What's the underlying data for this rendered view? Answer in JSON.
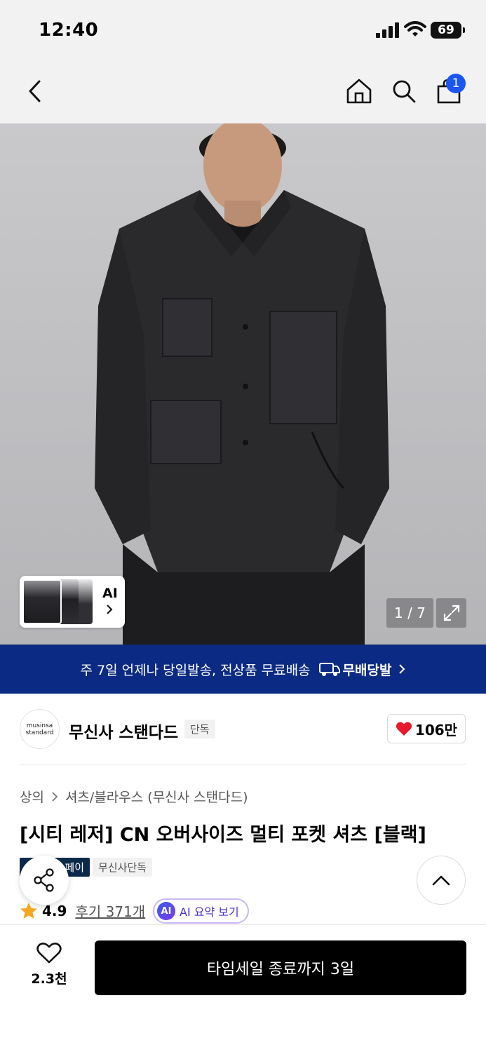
{
  "status_bar": {
    "time": "12:40",
    "battery": "69"
  },
  "nav": {
    "cart_count": "1"
  },
  "hero": {
    "ai_label": "AI",
    "counter": "1 / 7"
  },
  "banner": {
    "text": "주 7일 언제나 당일발송, 전상품 무료배송",
    "logo_text": "무배당발"
  },
  "brand": {
    "logo_text": "musinsa standard",
    "name": "무신사 스탠다드",
    "tag": "단독",
    "likes": "106만"
  },
  "product": {
    "breadcrumb": [
      "상의",
      "셔츠/블라우스 (무신사 스탠다드)"
    ],
    "title": "[시티 레저] CN 오버사이즈 멀티 포켓 셔츠 [블랙]",
    "tags": [
      "페이",
      "무신사단독"
    ],
    "rating": "4.9",
    "reviews": "후기 371개",
    "ai_summary": "AI 요약 보기",
    "ai_badge": "AI"
  },
  "bottom": {
    "wish_count": "2.3천",
    "buy_label": "타임세일 종료까지 3일"
  },
  "colors": {
    "banner": "#0b2a83",
    "badge": "#1a57f2",
    "heart": "#e8192c",
    "star": "#f5a623",
    "buy": "#000000"
  }
}
